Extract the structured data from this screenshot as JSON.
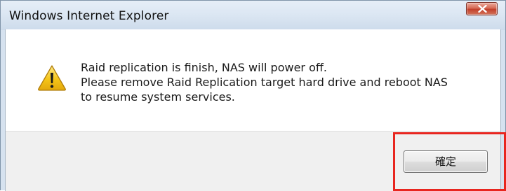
{
  "window": {
    "title": "Windows Internet Explorer"
  },
  "dialog": {
    "message_lines": [
      "Raid replication is finish, NAS will power off.",
      "Please remove Raid Replication target hard drive and reboot NAS",
      "to resume system services."
    ],
    "icon": "warning-icon",
    "ok_label": "確定"
  },
  "colors": {
    "highlight": "#e8261f",
    "close_button": "#c8452f",
    "warning_yellow": "#f5c518"
  }
}
